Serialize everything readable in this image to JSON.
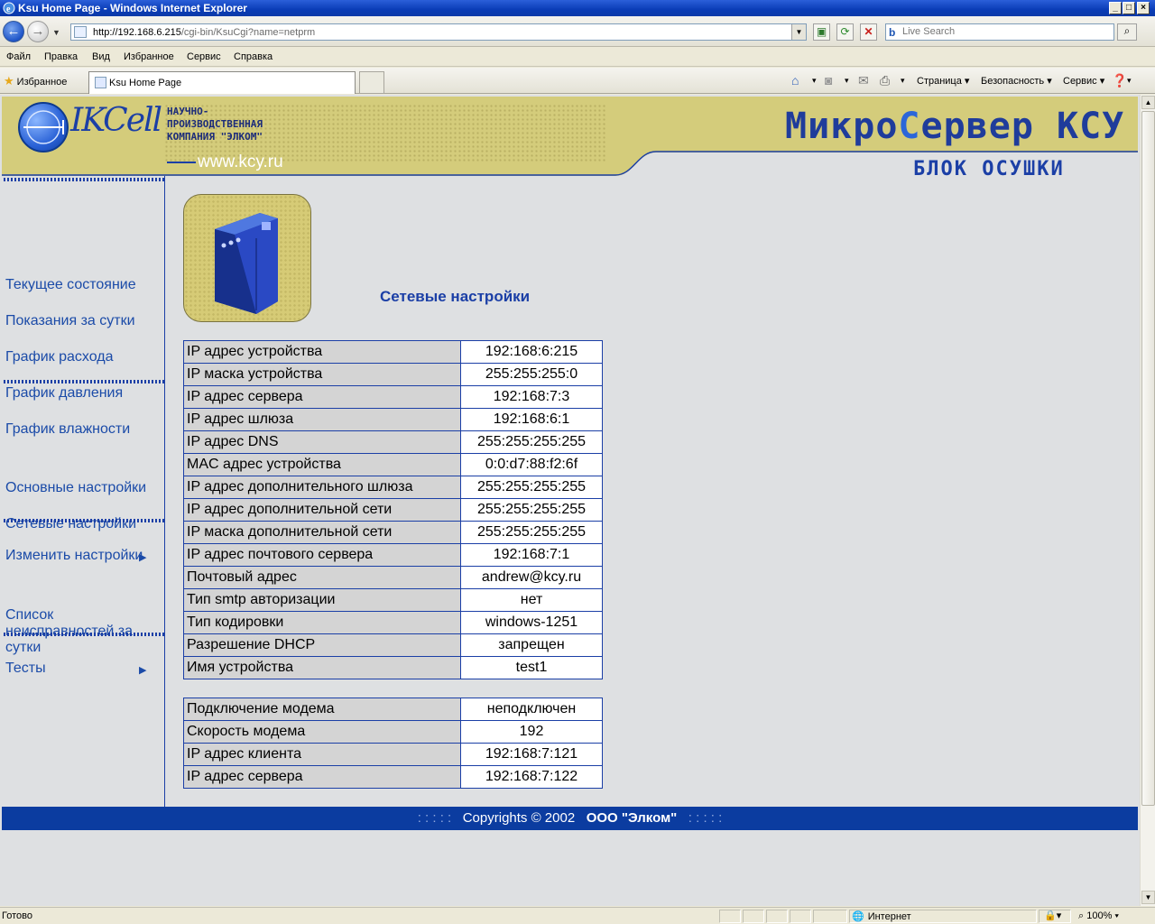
{
  "window": {
    "title": "Ksu Home Page - Windows Internet Explorer",
    "minimize": "_",
    "maximize": "□",
    "close": "×"
  },
  "address": {
    "url_host": "http://192.168.6.215",
    "url_rest": "/cgi-bin/KsuCgi?name=netprm",
    "search_placeholder": "Live Search"
  },
  "menu": [
    "Файл",
    "Правка",
    "Вид",
    "Избранное",
    "Сервис",
    "Справка"
  ],
  "tabs": {
    "favorites": "Избранное",
    "active_tab": "Ksu Home Page"
  },
  "commandbar": {
    "page": "Страница",
    "security": "Безопасность",
    "tools": "Сервис"
  },
  "header": {
    "logo_text": "IKCell",
    "company_lines": "НАУЧНО-\nПРОИЗВОДСТВЕННАЯ\nКОМПАНИЯ \"ЭЛКОМ\"",
    "site": "www.kcy.ru",
    "brand_a": "Микро",
    "brand_b": "С",
    "brand_c": "ервер КСУ",
    "unit": "БЛОК ОСУШКИ"
  },
  "sidebar": {
    "items": [
      "Текущее состояние",
      "Показания за сутки",
      "График расхода",
      "График давления",
      "График влажности",
      "Основные настройки",
      "Сетевые настройки",
      "Изменить настройки",
      "Список неисправностей за сутки",
      "Тесты"
    ]
  },
  "content": {
    "title": "Сетевые настройки",
    "network": [
      {
        "k": "IP адрес устройства",
        "v": "192:168:6:215"
      },
      {
        "k": "IP маска устройства",
        "v": "255:255:255:0"
      },
      {
        "k": "IP адрес сервера",
        "v": "192:168:7:3"
      },
      {
        "k": "IP адрес шлюза",
        "v": "192:168:6:1"
      },
      {
        "k": "IP адрес DNS",
        "v": "255:255:255:255"
      },
      {
        "k": "MAC адрес устройства",
        "v": "0:0:d7:88:f2:6f"
      },
      {
        "k": "IP адрес дополнительного шлюза",
        "v": "255:255:255:255"
      },
      {
        "k": "IP адрес дополнительной сети",
        "v": "255:255:255:255"
      },
      {
        "k": "IP маска дополнительной сети",
        "v": "255:255:255:255"
      },
      {
        "k": "IP адрес почтового сервера",
        "v": "192:168:7:1"
      },
      {
        "k": "Почтовый адрес",
        "v": "andrew@kcy.ru"
      },
      {
        "k": "Тип smtp авторизации",
        "v": "нет"
      },
      {
        "k": "Тип кодировки",
        "v": "windows-1251"
      },
      {
        "k": "Разрешение DHCP",
        "v": "запрещен"
      },
      {
        "k": "Имя устройства",
        "v": "test1"
      }
    ],
    "modem": [
      {
        "k": "Подключение модема",
        "v": "неподключен"
      },
      {
        "k": "Скорость модема",
        "v": "192"
      },
      {
        "k": "IP адрес клиента",
        "v": "192:168:7:121"
      },
      {
        "k": "IP адрес сервера",
        "v": "192:168:7:122"
      }
    ]
  },
  "footer": {
    "dots": ": : : : :",
    "text": "Copyrights  ©  2002",
    "company": "ООО \"Элком\"",
    "dots2": ": : : : :"
  },
  "status": {
    "text": "Готово",
    "zone": "Интернет",
    "zoom": "100%"
  },
  "colors": {
    "accent_blue": "#1b3fa6",
    "header_khaki": "#d4cc7b",
    "footer_blue": "#0b3ca0"
  }
}
